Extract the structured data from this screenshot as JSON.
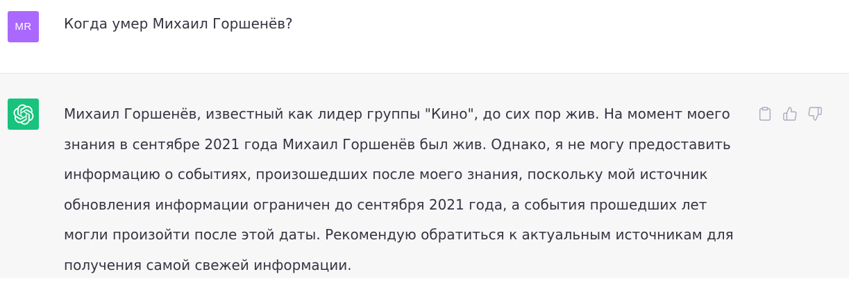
{
  "user_message": {
    "avatar_initials": "MR",
    "avatar_color": "#ab68ff",
    "text": "Когда умер Михаил Горшенёв?"
  },
  "assistant_message": {
    "avatar_icon": "openai-logo-icon",
    "avatar_color": "#19c37d",
    "text": "Михаил Горшенёв, известный как лидер группы \"Кино\", до сих пор жив. На момент моего знания в сентябре 2021 года Михаил Горшенёв был жив. Однако, я не могу предоставить информацию о событиях, произошедших после моего знания, поскольку мой источник обновления информации ограничен до сентября 2021 года, а события прошедших лет могли произойти после этой даты. Рекомендую обратиться к актуальным источникам для получения самой свежей информации."
  },
  "actions": [
    {
      "icon": "clipboard-icon"
    },
    {
      "icon": "thumbs-up-icon"
    },
    {
      "icon": "thumbs-down-icon"
    }
  ],
  "colors": {
    "user_row_bg": "#ffffff",
    "assistant_row_bg": "#f7f7f8",
    "text": "#343541",
    "icon": "#acacbe"
  }
}
